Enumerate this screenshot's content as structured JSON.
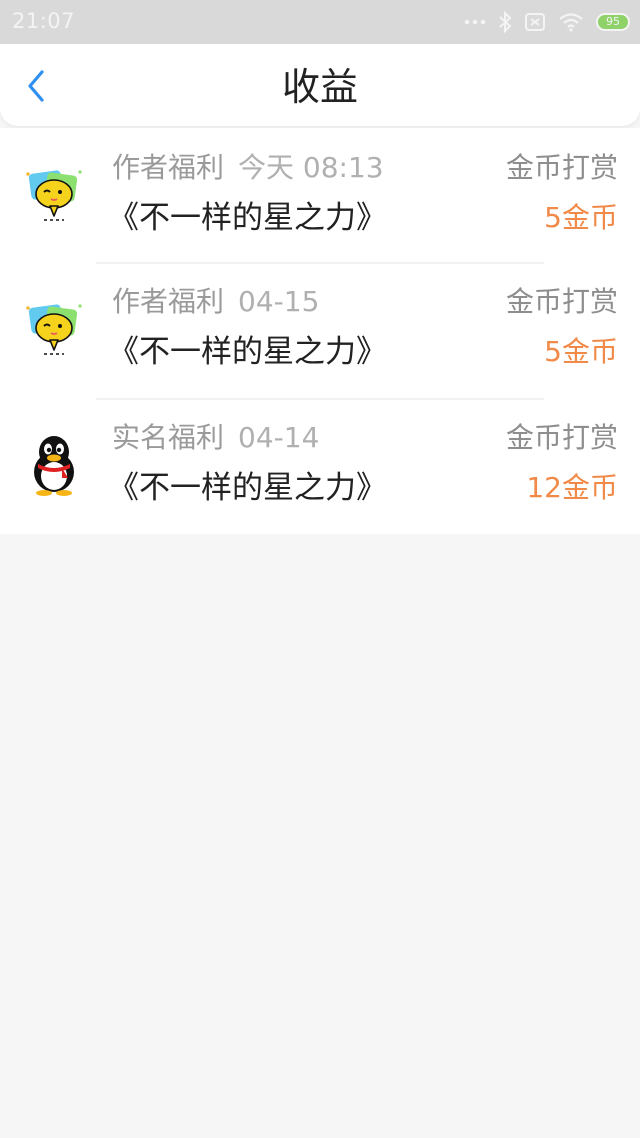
{
  "status_bar": {
    "time": "21:07",
    "battery_level": "95",
    "icons": [
      "dots-icon",
      "bluetooth-icon",
      "sim-icon",
      "wifi-icon",
      "battery-icon"
    ]
  },
  "header": {
    "title": "收益",
    "back_icon": "chevron-left-icon"
  },
  "colors": {
    "accent_blue": "#2f8ff0",
    "amount_orange": "#f18a48",
    "background": "#f7f6f7"
  },
  "list": {
    "items": [
      {
        "category": "作者福利",
        "date": "今天 08:13",
        "book_title": "《不一样的星之力》",
        "reward_type": "金币打赏",
        "amount": "5金币",
        "avatar_icon": "chat-bubble-emoji-icon"
      },
      {
        "category": "作者福利",
        "date": "04-15",
        "book_title": "《不一样的星之力》",
        "reward_type": "金币打赏",
        "amount": "5金币",
        "avatar_icon": "chat-bubble-emoji-icon"
      },
      {
        "category": "实名福利",
        "date": "04-14",
        "book_title": "《不一样的星之力》",
        "reward_type": "金币打赏",
        "amount": "12金币",
        "avatar_icon": "penguin-icon"
      }
    ]
  }
}
